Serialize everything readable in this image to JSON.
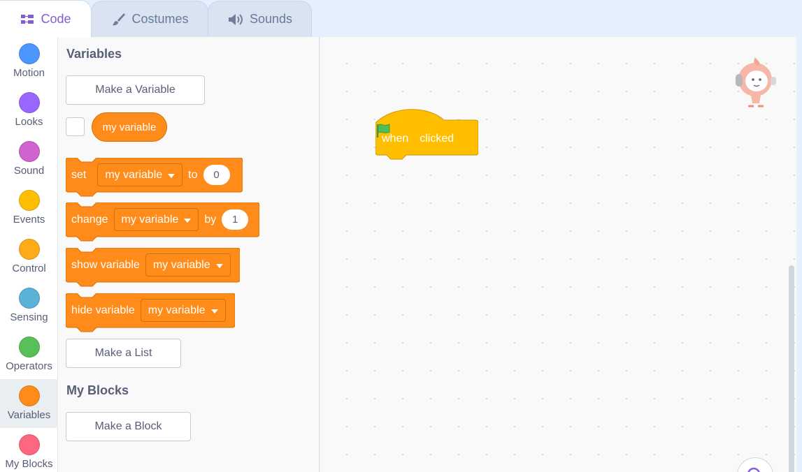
{
  "tabs": [
    {
      "label": "Code",
      "icon": "code-icon",
      "active": true
    },
    {
      "label": "Costumes",
      "icon": "brush-icon",
      "active": false
    },
    {
      "label": "Sounds",
      "icon": "speaker-icon",
      "active": false
    }
  ],
  "categories": [
    {
      "label": "Motion",
      "color": "#4c97ff"
    },
    {
      "label": "Looks",
      "color": "#9966ff"
    },
    {
      "label": "Sound",
      "color": "#cf63cf"
    },
    {
      "label": "Events",
      "color": "#ffbf00"
    },
    {
      "label": "Control",
      "color": "#ffab19"
    },
    {
      "label": "Sensing",
      "color": "#5cb1d6"
    },
    {
      "label": "Operators",
      "color": "#59c059"
    },
    {
      "label": "Variables",
      "color": "#ff8c1a",
      "selected": true
    },
    {
      "label": "My Blocks",
      "color": "#ff6680"
    }
  ],
  "flyout": {
    "variables_title": "Variables",
    "make_variable": "Make a Variable",
    "variable_reporter": "my variable",
    "set_block": {
      "label": "set",
      "var": "my variable",
      "to": "to",
      "value": "0"
    },
    "change_block": {
      "label": "change",
      "var": "my variable",
      "by": "by",
      "value": "1"
    },
    "show_block": {
      "label": "show variable",
      "var": "my variable"
    },
    "hide_block": {
      "label": "hide variable",
      "var": "my variable"
    },
    "make_list": "Make a List",
    "myblocks_title": "My Blocks",
    "make_block": "Make a Block"
  },
  "workspace": {
    "hat_block": {
      "when": "when",
      "clicked": "clicked",
      "color": "#ffbf00"
    }
  }
}
